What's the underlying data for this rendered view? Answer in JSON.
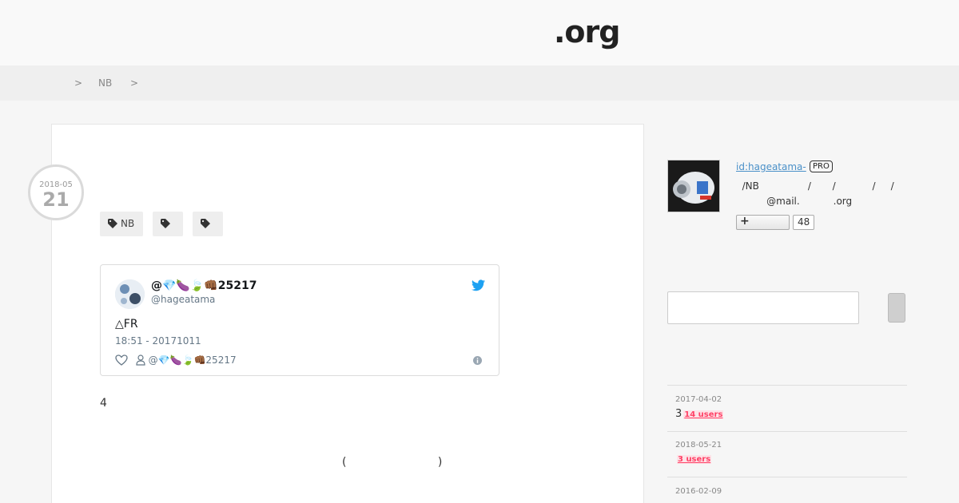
{
  "header": {
    "site_title": ".org"
  },
  "breadcrumb": {
    "sep1": ">",
    "item1": "NB",
    "sep2": ">"
  },
  "entry": {
    "date_ym": "2018-05",
    "date_day": "21",
    "tags": [
      "NB",
      "",
      ""
    ],
    "tweet": {
      "display_name": "@💎🍆🍃👊🏾25217",
      "handle": "@hageatama",
      "text": "△FR",
      "time": "18:51 - 20171011",
      "user_line": "@💎🍆🍃👊🏾25217"
    },
    "text1": "4",
    "text2": "(     )"
  },
  "profile": {
    "id": "id:hageatama-",
    "badge": "PRO",
    "desc_line1": "  /NB                /       /            /     /",
    "desc_line2": "          @mail.           .org",
    "follow_label": "+",
    "follow_count": "48"
  },
  "sidebar": {
    "related": [
      {
        "date": "2017-04-02",
        "prefix": "3",
        "users": "14 users"
      },
      {
        "date": "2018-05-21",
        "prefix": "",
        "users": "3 users"
      },
      {
        "date": "2016-02-09",
        "prefix": "",
        "users": ""
      }
    ]
  },
  "colors": {
    "link": "#4a90c8",
    "users_badge": "#ff4166",
    "twitter": "#1da1f2"
  }
}
